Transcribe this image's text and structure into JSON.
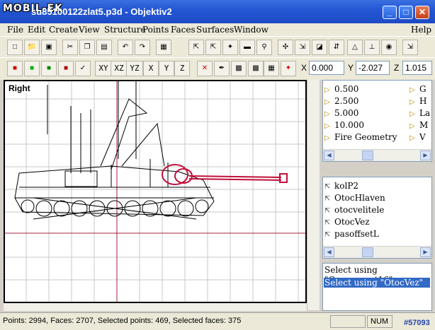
{
  "window": {
    "watermark": "MOBIL-EK",
    "title": "su85100122zlat5.p3d - Objektiv2",
    "min_label": "_",
    "max_label": "□",
    "close_label": "✕"
  },
  "menu": [
    {
      "label": "File"
    },
    {
      "label": "Edit"
    },
    {
      "label": "Create"
    },
    {
      "label": "View"
    },
    {
      "label": "Structure"
    },
    {
      "label": "Points"
    },
    {
      "label": "Faces"
    },
    {
      "label": "Surfaces"
    },
    {
      "label": "Window"
    },
    {
      "label": "Help"
    }
  ],
  "toolbar2": {
    "axis_buttons": [
      "XY",
      "XZ",
      "YZ",
      "X",
      "Y",
      "Z"
    ],
    "x_label": "X",
    "x_value": "0.000",
    "y_label": "Y",
    "y_value": "-2.027",
    "z_label": "Z",
    "z_value": "1.015"
  },
  "viewport": {
    "label": "Right"
  },
  "lod_list": {
    "items": [
      "0.500",
      "2.500",
      "5.000",
      "10.000",
      "Fire Geometry"
    ],
    "col2": [
      "G",
      "H",
      "La",
      "M",
      "V"
    ]
  },
  "selection_list": {
    "items": [
      "kolP2",
      "OtocHlaven",
      "otocvelitele",
      "OtocVez",
      "pasoffsetL"
    ]
  },
  "select_panel": {
    "items": [
      "Select using \"Component16\"",
      "Select using \"OtocVez\""
    ]
  },
  "status": {
    "text": "Points: 2994, Faces: 2707, Selected points: 469, Selected faces: 375",
    "num": "NUM",
    "badge": "#57093"
  },
  "colors": {
    "title_bar": "#2457d4",
    "selected": "#316ac5",
    "gun_highlight": "#c0103a"
  }
}
